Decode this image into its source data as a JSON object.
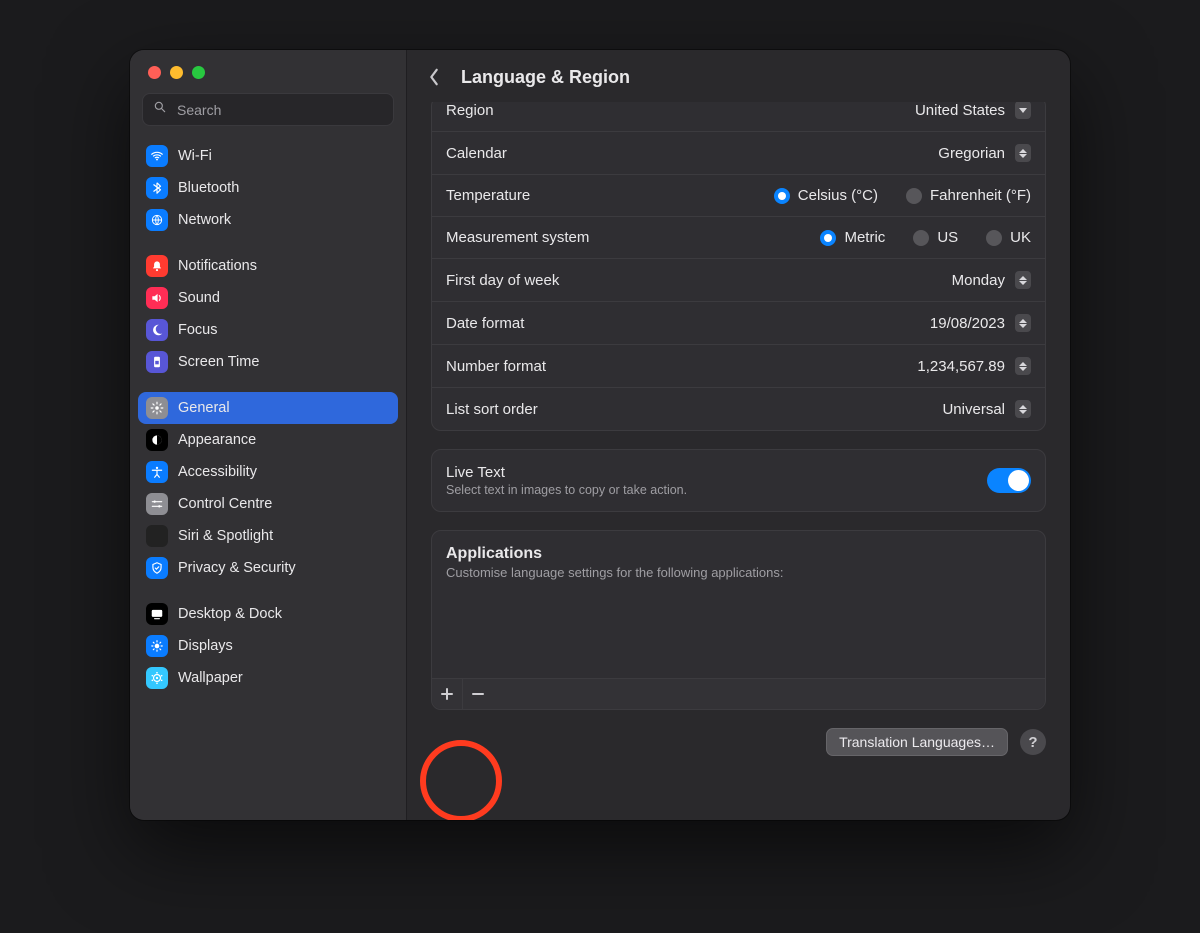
{
  "window": {
    "title": "Language & Region"
  },
  "search": {
    "placeholder": "Search"
  },
  "sidebar": {
    "groups": [
      {
        "items": [
          {
            "label": "Wi-Fi",
            "icon_bg": "#0a7cff"
          },
          {
            "label": "Bluetooth",
            "icon_bg": "#0a7cff"
          },
          {
            "label": "Network",
            "icon_bg": "#0a7cff"
          }
        ]
      },
      {
        "items": [
          {
            "label": "Notifications",
            "icon_bg": "#ff3b30"
          },
          {
            "label": "Sound",
            "icon_bg": "#ff2d55"
          },
          {
            "label": "Focus",
            "icon_bg": "#5856d6"
          },
          {
            "label": "Screen Time",
            "icon_bg": "#5856d6"
          }
        ]
      },
      {
        "items": [
          {
            "label": "General",
            "icon_bg": "#8e8e93",
            "selected": true
          },
          {
            "label": "Appearance",
            "icon_bg": "#000000"
          },
          {
            "label": "Accessibility",
            "icon_bg": "#0a7cff"
          },
          {
            "label": "Control Centre",
            "icon_bg": "#8e8e93"
          },
          {
            "label": "Siri & Spotlight",
            "icon_bg": "#222222"
          },
          {
            "label": "Privacy & Security",
            "icon_bg": "#0a7cff"
          }
        ]
      },
      {
        "items": [
          {
            "label": "Desktop & Dock",
            "icon_bg": "#000000"
          },
          {
            "label": "Displays",
            "icon_bg": "#0a7cff"
          },
          {
            "label": "Wallpaper",
            "icon_bg": "#34c8ff"
          }
        ]
      }
    ]
  },
  "settings": {
    "region": {
      "label": "Region",
      "value": "United States"
    },
    "calendar": {
      "label": "Calendar",
      "value": "Gregorian"
    },
    "temperature": {
      "label": "Temperature",
      "options": [
        "Celsius (°C)",
        "Fahrenheit (°F)"
      ],
      "selected": 0
    },
    "measurement": {
      "label": "Measurement system",
      "options": [
        "Metric",
        "US",
        "UK"
      ],
      "selected": 0
    },
    "first_day": {
      "label": "First day of week",
      "value": "Monday"
    },
    "date_format": {
      "label": "Date format",
      "value": "19/08/2023"
    },
    "number_format": {
      "label": "Number format",
      "value": "1,234,567.89"
    },
    "list_sort": {
      "label": "List sort order",
      "value": "Universal"
    }
  },
  "live_text": {
    "title": "Live Text",
    "subtitle": "Select text in images to copy or take action.",
    "enabled": true
  },
  "applications": {
    "title": "Applications",
    "subtitle": "Customise language settings for the following applications:"
  },
  "footer": {
    "translation_button": "Translation Languages…",
    "help": "?"
  }
}
